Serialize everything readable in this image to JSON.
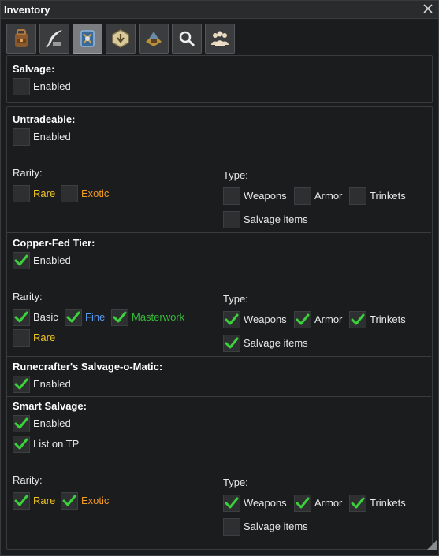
{
  "window": {
    "title": "Inventory"
  },
  "tabs": [
    {
      "icon": "backpack-icon"
    },
    {
      "icon": "quill-icon"
    },
    {
      "icon": "salvage-kit-icon",
      "active": true
    },
    {
      "icon": "deposit-icon"
    },
    {
      "icon": "material-bag-icon"
    },
    {
      "icon": "magnifier-icon"
    },
    {
      "icon": "group-icon"
    }
  ],
  "labels": {
    "rarity": "Rarity:",
    "type": "Type:",
    "enabled": "Enabled",
    "list_on_tp": "List on TP",
    "rare": "Rare",
    "exotic": "Exotic",
    "basic": "Basic",
    "fine": "Fine",
    "masterwork": "Masterwork",
    "weapons": "Weapons",
    "armor": "Armor",
    "trinkets": "Trinkets",
    "salvage_items": "Salvage items"
  },
  "sections": {
    "salvage": {
      "heading": "Salvage:",
      "enabled": false
    },
    "untradeable": {
      "heading": "Untradeable:",
      "enabled": false,
      "rarity": {
        "rare": false,
        "exotic": false
      },
      "type": {
        "weapons": false,
        "armor": false,
        "trinkets": false,
        "salvage_items": false
      }
    },
    "copper_fed": {
      "heading": "Copper-Fed Tier:",
      "enabled": true,
      "rarity": {
        "basic": true,
        "fine": true,
        "masterwork": true,
        "rare": false
      },
      "type": {
        "weapons": true,
        "armor": true,
        "trinkets": true,
        "salvage_items": true
      }
    },
    "runecrafter": {
      "heading": "Runecrafter's Salvage-o-Matic:",
      "enabled": true
    },
    "smart": {
      "heading": "Smart Salvage:",
      "enabled": true,
      "list_on_tp": true,
      "rarity": {
        "rare": true,
        "exotic": true
      },
      "type": {
        "weapons": true,
        "armor": true,
        "trinkets": true,
        "salvage_items": false
      }
    }
  },
  "colors": {
    "rare": "#f2c522",
    "exotic": "#f29a22",
    "fine": "#5a9cf2",
    "masterwork": "#38b83a",
    "check": "#3bd13b"
  }
}
